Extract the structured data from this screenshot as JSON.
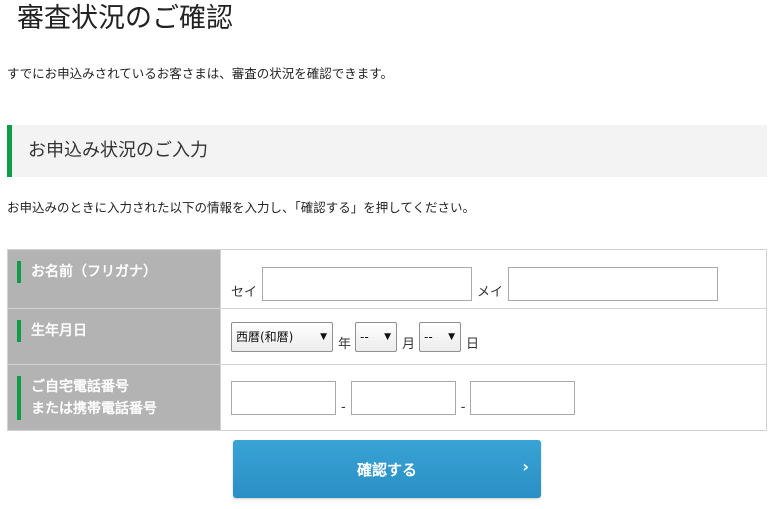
{
  "page": {
    "title": "審査状況のご確認",
    "intro": "すでにお申込みされているお客さまは、審査の状況を確認できます。"
  },
  "section": {
    "heading": "お申込み状況のご入力",
    "instruction": "お申込みのときに入力された以下の情報を入力し、「確認する」を押してください。"
  },
  "form": {
    "name_row": {
      "label": "お名前（フリガナ）",
      "sei_label": "セイ",
      "mei_label": "メイ",
      "sei_value": "",
      "mei_value": ""
    },
    "birth_row": {
      "label": "生年月日",
      "era_selected": "西暦(和暦)",
      "year_unit": "年",
      "month_selected": "--",
      "month_unit": "月",
      "day_selected": "--",
      "day_unit": "日"
    },
    "phone_row": {
      "label_line1": "ご自宅電話番号",
      "label_line2": "または携帯電話番号",
      "separator": "-",
      "part1": "",
      "part2": "",
      "part3": ""
    }
  },
  "submit": {
    "label": "確認する",
    "chevron": "›"
  },
  "colors": {
    "accent_green": "#0d9c4a",
    "button_blue": "#2f9ccf",
    "label_gray": "#b3b3b3"
  }
}
